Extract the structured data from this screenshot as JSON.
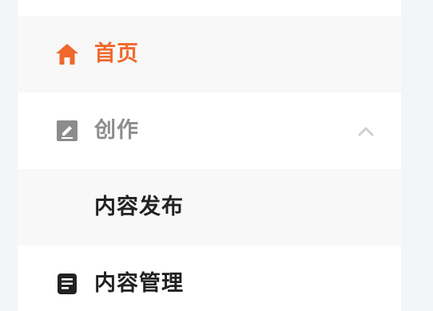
{
  "menu": {
    "home": {
      "label": "首页",
      "icon": "home-icon",
      "color": "#f0682d"
    },
    "create": {
      "label": "创作",
      "icon": "edit-note-icon",
      "color": "#8c8c8c",
      "expanded": true
    },
    "publish": {
      "label": "内容发布"
    },
    "manage": {
      "label": "内容管理",
      "icon": "document-icon"
    }
  },
  "colors": {
    "accent": "#f0682d",
    "muted": "#8c8c8c",
    "text": "#222222",
    "selected_bg": "#f8f8f8"
  }
}
